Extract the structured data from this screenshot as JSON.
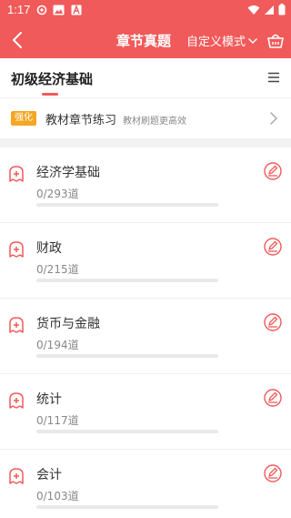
{
  "status_bar": {
    "time": "1:17",
    "icons": [
      "settings-notification-icon",
      "image-icon",
      "a-notification-icon",
      "wifi-icon",
      "signal-icon",
      "battery-icon"
    ]
  },
  "app_bar": {
    "title": "章节真题",
    "mode_label": "自定义模式",
    "icons": [
      "back-arrow-icon",
      "chevron-down-icon",
      "basket-icon"
    ]
  },
  "subject": {
    "name": "初级经济基础",
    "icon": "menu-icon"
  },
  "practice": {
    "tag": "强化",
    "title": "教材章节练习",
    "description": "教材刷题更高效"
  },
  "chapters": [
    {
      "title": "经济学基础",
      "count": "0/293道",
      "progress": 0
    },
    {
      "title": "财政",
      "count": "0/215道",
      "progress": 0
    },
    {
      "title": "货币与金融",
      "count": "0/194道",
      "progress": 0
    },
    {
      "title": "统计",
      "count": "0/117道",
      "progress": 0
    },
    {
      "title": "会计",
      "count": "0/103道",
      "progress": 0
    }
  ],
  "colors": {
    "accent": "#f15a5a",
    "tag": "#f5a623"
  }
}
